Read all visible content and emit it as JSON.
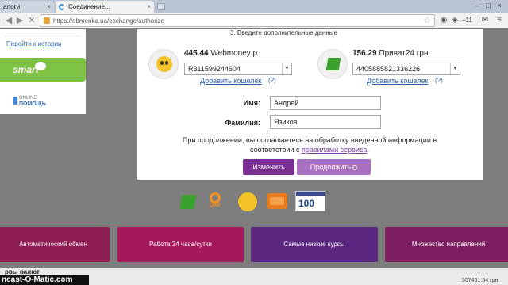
{
  "browser": {
    "tab_inactive_label": "алоги",
    "tab_active_label": "Соединение...",
    "url": "https://obmenka.ua/exchange/authorize",
    "counter": "+11",
    "icons": [
      "back-icon",
      "forward-icon",
      "reload-icon",
      "lock-icon",
      "star-icon",
      "menu-icon",
      "close-icon"
    ]
  },
  "sidebar": {
    "history_link": "Перейти к истории",
    "smart_label": "smart",
    "online_line1": "ONLINE",
    "online_line2": "ПОМОЩЬ"
  },
  "form": {
    "step_title": "3. Введите дополнительные данные",
    "from": {
      "amount": "445.44",
      "currency": "Webmoney р.",
      "account": "R311599244604",
      "add_link": "Добавить кошелек",
      "help": "(?)"
    },
    "to": {
      "amount": "156.29",
      "currency": "Приват24 грн.",
      "account": "4405885821336226",
      "add_link": "Добавить кошелек",
      "help": "(?)"
    },
    "first_name_label": "Имя:",
    "first_name_value": "Андрей",
    "last_name_label": "Фамилия:",
    "last_name_value": "Язиков",
    "consent_text": "При продолжении, вы соглашаетесь на обработку введенной информации в соответствии с",
    "consent_link": "правилами сервиса",
    "consent_end": ".",
    "change_button": "Изменить",
    "continue_button": "Продолжить"
  },
  "payment_icons": {
    "qiwi_label": "QIWI",
    "wmz_number": "100",
    "names": [
      "privat-icon",
      "qiwi-icon",
      "webmoney-icon",
      "yandex-money-icon",
      "wmz-icon"
    ]
  },
  "features": [
    {
      "label": "Автоматический обмен"
    },
    {
      "label": "Работа 24 часа/сутки"
    },
    {
      "label": "Самые низкие курсы"
    },
    {
      "label": "Множество направлений"
    }
  ],
  "footer": {
    "rates_title": "рвы валют",
    "watermark": "ncast-O-Matic.com",
    "number": "357451.54 грн"
  },
  "colors": {
    "purple_button": "#7a2e93",
    "light_purple_button": "#a970c1",
    "smart_green": "#7dc243",
    "link_blue": "#2a5db0"
  }
}
